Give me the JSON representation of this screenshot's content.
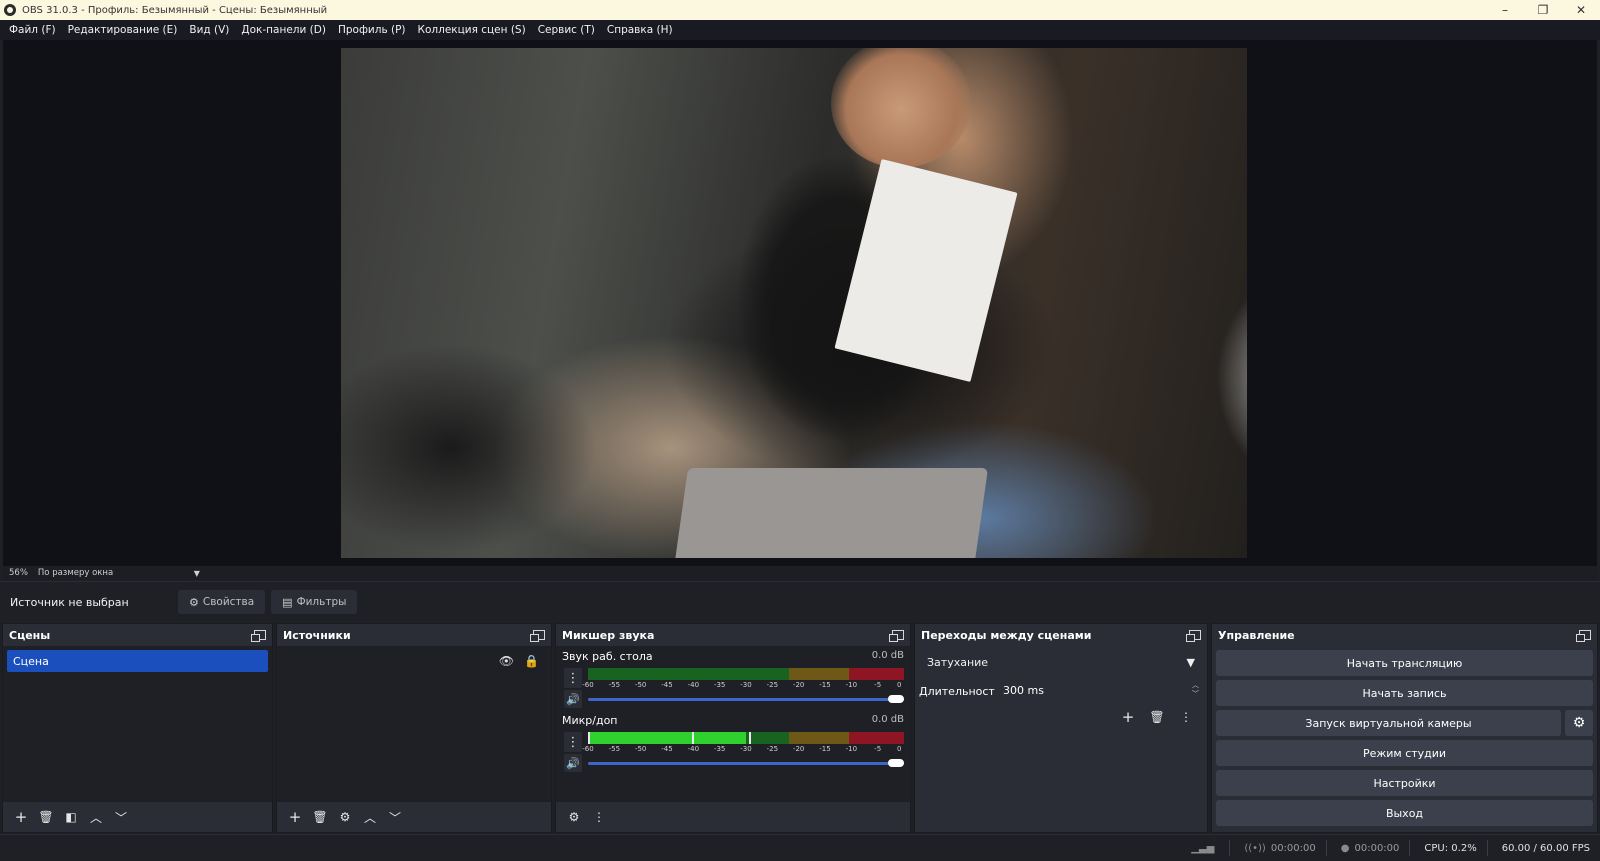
{
  "window": {
    "title": "OBS 31.0.3 - Профиль: Безымянный - Сцены: Безымянный",
    "controls": {
      "minimize": "–",
      "restore": "❐",
      "close": "✕"
    }
  },
  "menu": [
    "Файл (F)",
    "Редактирование (E)",
    "Вид (V)",
    "Док-панели (D)",
    "Профиль (P)",
    "Коллекция сцен (S)",
    "Сервис (T)",
    "Справка (H)"
  ],
  "preview": {
    "zoom": "56%",
    "scale_mode": "По размеру окна"
  },
  "source_toolbar": {
    "no_source": "Источник не выбран",
    "properties": "Свойства",
    "filters": "Фильтры"
  },
  "scenes": {
    "title": "Сцены",
    "items": [
      "Сцена"
    ]
  },
  "sources": {
    "title": "Источники"
  },
  "mixer": {
    "title": "Микшер звука",
    "channels": [
      {
        "name": "Звук раб. стола",
        "level": "0.0 dB",
        "volume_fraction": 1.0
      },
      {
        "name": "Микр/доп",
        "level": "0.0 dB",
        "volume_fraction": 1.0,
        "meter_level_db": -30
      }
    ],
    "ticks": [
      "-60",
      "-55",
      "-50",
      "-45",
      "-40",
      "-35",
      "-30",
      "-25",
      "-20",
      "-15",
      "-10",
      "-5",
      "0"
    ]
  },
  "transitions": {
    "title": "Переходы между сценами",
    "selected": "Затухание",
    "duration_label": "Длительность",
    "duration_value": "300 ms"
  },
  "controls": {
    "title": "Управление",
    "buttons": {
      "stream": "Начать трансляцию",
      "record": "Начать запись",
      "virtual_cam": "Запуск виртуальной камеры",
      "studio": "Режим студии",
      "settings": "Настройки",
      "exit": "Выход"
    }
  },
  "status": {
    "stream_time": "00:00:00",
    "record_time": "00:00:00",
    "cpu": "CPU: 0.2%",
    "fps": "60.00 / 60.00 FPS"
  },
  "colors": {
    "scene_selected": "#1b4fbd",
    "meter_green": "#2fd12f",
    "meter_yellow": "#c59a1f",
    "meter_red": "#c8212f",
    "slider": "#3b67c9"
  }
}
